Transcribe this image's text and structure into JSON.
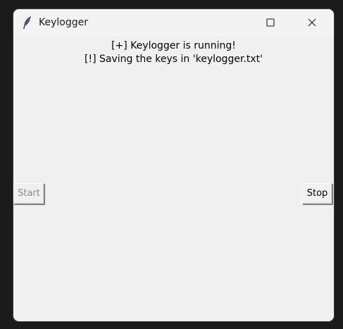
{
  "window": {
    "title": "Keylogger",
    "icon": "feather-icon"
  },
  "titlebar_controls": {
    "minimize_icon": "minimize-icon",
    "maximize_icon": "maximize-icon",
    "close_icon": "close-icon"
  },
  "status": {
    "line1": "[+] Keylogger is running!",
    "line2": "[!] Saving the keys in 'keylogger.txt'"
  },
  "buttons": {
    "start_label": "Start",
    "start_state": "disabled",
    "stop_label": "Stop"
  },
  "colors": {
    "window_bg": "#f0f0f0",
    "desktop_bg": "#1b1b1b",
    "disabled_text": "#8a8a8a"
  }
}
